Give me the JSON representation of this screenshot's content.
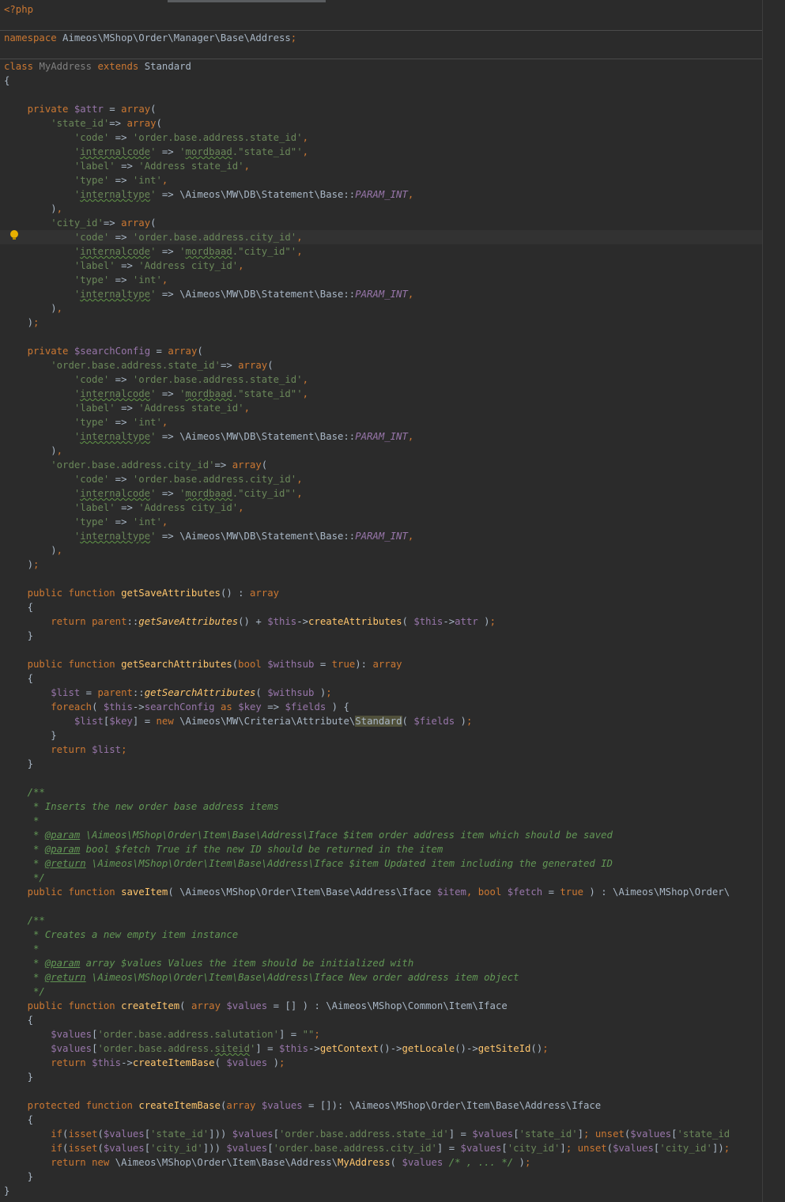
{
  "editor": {
    "language": "php",
    "colors": {
      "background": "#2b2b2b",
      "keyword": "#cc7832",
      "string": "#6a8759",
      "variable": "#9876aa",
      "function": "#ffc66d",
      "comment": "#629755",
      "text": "#a9b7c6"
    },
    "intention_icon": "lightbulb-icon",
    "code_lines": [
      "<?php",
      "",
      "namespace Aimeos\\MShop\\Order\\Manager\\Base\\Address;",
      "",
      "class MyAddress extends Standard",
      "{",
      "",
      "    private $attr = array(",
      "        'state_id'=> array(",
      "            'code' => 'order.base.address.state_id',",
      "            'internalcode' => 'mordbaad.\"state_id\"',",
      "            'label' => 'Address state_id',",
      "            'type' => 'int',",
      "            'internaltype' => \\Aimeos\\MW\\DB\\Statement\\Base::PARAM_INT,",
      "        ),",
      "        'city_id'=> array(",
      "            'code' => 'order.base.address.city_id',",
      "            'internalcode' => 'mordbaad.\"city_id\"',",
      "            'label' => 'Address city_id',",
      "            'type' => 'int',",
      "            'internaltype' => \\Aimeos\\MW\\DB\\Statement\\Base::PARAM_INT,",
      "        ),",
      "    );",
      "",
      "    private $searchConfig = array(",
      "        'order.base.address.state_id'=> array(",
      "            'code' => 'order.base.address.state_id',",
      "            'internalcode' => 'mordbaad.\"state_id\"',",
      "            'label' => 'Address state_id',",
      "            'type' => 'int',",
      "            'internaltype' => \\Aimeos\\MW\\DB\\Statement\\Base::PARAM_INT,",
      "        ),",
      "        'order.base.address.city_id'=> array(",
      "            'code' => 'order.base.address.city_id',",
      "            'internalcode' => 'mordbaad.\"city_id\"',",
      "            'label' => 'Address city_id',",
      "            'type' => 'int',",
      "            'internaltype' => \\Aimeos\\MW\\DB\\Statement\\Base::PARAM_INT,",
      "        ),",
      "    );",
      "",
      "    public function getSaveAttributes() : array",
      "    {",
      "        return parent::getSaveAttributes() + $this->createAttributes( $this->attr );",
      "    }",
      "",
      "    public function getSearchAttributes(bool $withsub = true): array",
      "    {",
      "        $list = parent::getSearchAttributes( $withsub );",
      "        foreach( $this->searchConfig as $key => $fields ) {",
      "            $list[$key] = new \\Aimeos\\MW\\Criteria\\Attribute\\Standard( $fields );",
      "        }",
      "        return $list;",
      "    }",
      "",
      "    /**",
      "     * Inserts the new order base address items",
      "     *",
      "     * @param \\Aimeos\\MShop\\Order\\Item\\Base\\Address\\Iface $item order address item which should be saved",
      "     * @param bool $fetch True if the new ID should be returned in the item",
      "     * @return \\Aimeos\\MShop\\Order\\Item\\Base\\Address\\Iface $item Updated item including the generated ID",
      "     */",
      "    public function saveItem( \\Aimeos\\MShop\\Order\\Item\\Base\\Address\\Iface $item, bool $fetch = true ) : \\Aimeos\\MShop\\Order\\",
      "",
      "    /**",
      "     * Creates a new empty item instance",
      "     *",
      "     * @param array $values Values the item should be initialized with",
      "     * @return \\Aimeos\\MShop\\Order\\Item\\Base\\Address\\Iface New order address item object",
      "     */",
      "    public function createItem( array $values = [] ) : \\Aimeos\\MShop\\Common\\Item\\Iface",
      "    {",
      "        $values['order.base.address.salutation'] = \"\";",
      "        $values['order.base.address.siteid'] = $this->getContext()->getLocale()->getSiteId();",
      "        return $this->createItemBase( $values );",
      "    }",
      "",
      "    protected function createItemBase(array $values = []): \\Aimeos\\MShop\\Order\\Item\\Base\\Address\\Iface",
      "    {",
      "        if(isset($values['state_id'])) $values['order.base.address.state_id'] = $values['state_id']; unset($values['state_id",
      "        if(isset($values['city_id'])) $values['order.base.address.city_id'] = $values['city_id']; unset($values['city_id']);",
      "        return new \\Aimeos\\MShop\\Order\\Item\\Base\\Address\\MyAddress( $values /* , ... */ );",
      "    }",
      "}"
    ]
  }
}
